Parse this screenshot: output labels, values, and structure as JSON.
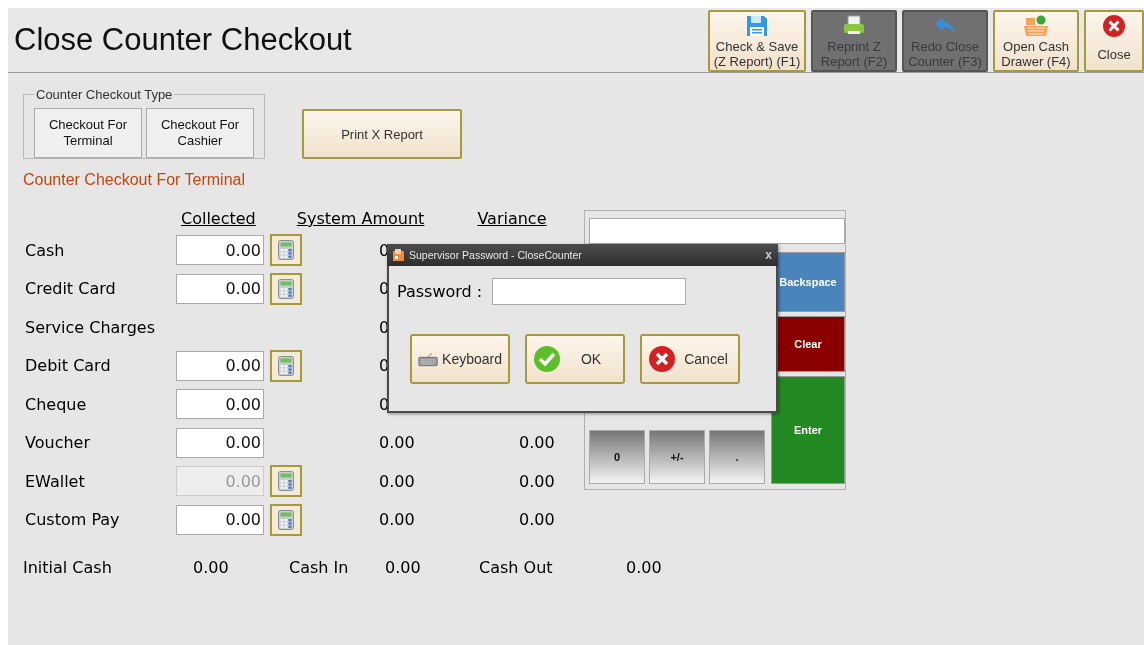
{
  "window": {
    "title": "Close Counter Checkout"
  },
  "toolbar": [
    {
      "kind": "save",
      "label": "Check & Save\n(Z Report) (F1)",
      "disabled": false
    },
    {
      "kind": "printer",
      "label": "Reprint Z\nReport (F2)",
      "disabled": true
    },
    {
      "kind": "undo",
      "label": "Redo Close\nCounter (F3)",
      "disabled": true
    },
    {
      "kind": "register",
      "label": "Open Cash\nDrawer (F4)",
      "disabled": false
    },
    {
      "kind": "close",
      "label": "Close",
      "disabled": false
    }
  ],
  "checkout_type": {
    "title": "Counter Checkout Type",
    "buttons": [
      "Checkout For\nTerminal",
      "Checkout For\nCashier"
    ]
  },
  "print_x_report": "Print X Report",
  "subtitle": "Counter Checkout For Terminal",
  "columns": [
    "Collected",
    "System Amount",
    "Variance"
  ],
  "rows": [
    {
      "label": "Cash",
      "collected": "0.00",
      "disabled": false,
      "calculator": true,
      "system_amount": "0"
    },
    {
      "label": "Credit Card",
      "collected": "0.00",
      "disabled": false,
      "calculator": true,
      "system_amount": "0"
    },
    {
      "label": "Service Charges",
      "calculator": false,
      "system_amount": "0"
    },
    {
      "label": "Debit Card",
      "collected": "0.00",
      "disabled": false,
      "calculator": true,
      "system_amount": "0"
    },
    {
      "label": "Cheque",
      "collected": "0.00",
      "disabled": false,
      "calculator": false,
      "system_amount": "0"
    },
    {
      "label": "Voucher",
      "collected": "0.00",
      "disabled": false,
      "calculator": false,
      "system_amount": "0.00",
      "variance": "0.00"
    },
    {
      "label": "EWallet",
      "collected": "0.00",
      "disabled": true,
      "calculator": true,
      "system_amount": "0.00",
      "variance": "0.00"
    },
    {
      "label": "Custom Pay",
      "collected": "0.00",
      "disabled": false,
      "calculator": true,
      "system_amount": "0.00",
      "variance": "0.00"
    }
  ],
  "totals": [
    {
      "label": "Initial Cash",
      "value": "0.00"
    },
    {
      "label": "Cash In",
      "value": "0.00"
    },
    {
      "label": "Cash Out",
      "value": "0.00"
    }
  ],
  "keypad": {
    "side_keys": [
      {
        "kind": "backspace",
        "label": "Backspace"
      },
      {
        "kind": "clear",
        "label": "Clear"
      },
      {
        "kind": "enter",
        "label": "Enter"
      }
    ],
    "bottom_keys": [
      "0",
      "+/-",
      "."
    ]
  },
  "dialog": {
    "title": "Supervisor Password - CloseCounter",
    "close": "x",
    "password_label": "Password :",
    "buttons": [
      {
        "kind": "keyboard",
        "label": "Keyboard"
      },
      {
        "kind": "ok",
        "label": "OK"
      },
      {
        "kind": "cancel",
        "label": "Cancel"
      }
    ]
  }
}
